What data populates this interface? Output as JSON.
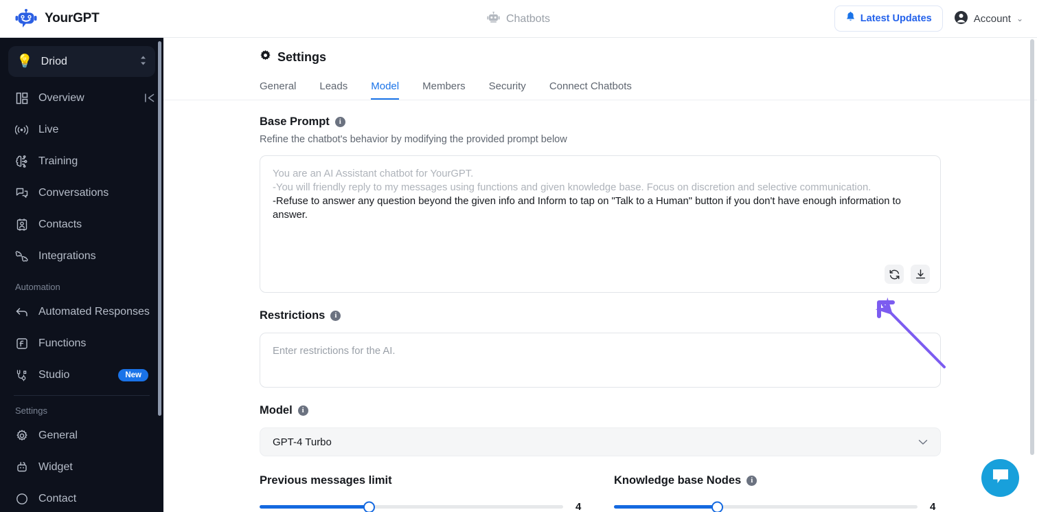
{
  "topbar": {
    "brand_name": "YourGPT",
    "brand_logo_icon": "robot-logo-icon",
    "center_label": "Chatbots",
    "center_icon": "robot-icon",
    "latest_updates_label": "Latest Updates",
    "latest_updates_icon": "bell-icon",
    "account_label": "Account",
    "account_icon": "user-circle-icon",
    "account_chevron_icon": "chevron-down-icon"
  },
  "sidebar": {
    "bot_selector": {
      "icon": "lightbulb-icon",
      "name": "Driod",
      "control_icon": "chevron-up-down-icon"
    },
    "collapse_icon": "collapse-panel-icon",
    "items": [
      {
        "label": "Overview",
        "icon": "layout-dashboard-icon"
      },
      {
        "label": "Live",
        "icon": "broadcast-icon"
      },
      {
        "label": "Training",
        "icon": "brain-circuit-icon"
      },
      {
        "label": "Conversations",
        "icon": "chat-bubbles-icon"
      },
      {
        "label": "Contacts",
        "icon": "contact-card-icon"
      },
      {
        "label": "Integrations",
        "icon": "puzzle-icon"
      }
    ],
    "group_automation_label": "Automation",
    "automation_items": [
      {
        "label": "Automated Responses",
        "icon": "reply-arrow-icon",
        "badge": ""
      },
      {
        "label": "Functions",
        "icon": "function-box-icon",
        "badge": ""
      },
      {
        "label": "Studio",
        "icon": "studio-node-icon",
        "badge": "New"
      }
    ],
    "group_settings_label": "Settings",
    "settings_items": [
      {
        "label": "General",
        "icon": "gear-icon"
      },
      {
        "label": "Widget",
        "icon": "widget-robot-icon"
      },
      {
        "label": "Contact",
        "icon": "contact-icon"
      }
    ]
  },
  "main": {
    "page_icon": "gear-icon",
    "page_title": "Settings",
    "tabs": [
      {
        "label": "General",
        "active": false
      },
      {
        "label": "Leads",
        "active": false
      },
      {
        "label": "Model",
        "active": true
      },
      {
        "label": "Members",
        "active": false
      },
      {
        "label": "Security",
        "active": false
      },
      {
        "label": "Connect Chatbots",
        "active": false
      }
    ],
    "base_prompt": {
      "label": "Base Prompt",
      "info_icon": "info-icon",
      "description": "Refine the chatbot's behavior by modifying the provided prompt below",
      "line1": "You are an AI Assistant chatbot for YourGPT.",
      "line2": "-You will friendly reply to my messages using functions and given knowledge base. Focus on discretion and selective communication.",
      "line3": "-Refuse to answer any question beyond the given info and Inform to tap on \"Talk to a Human\" button if you don't have enough information to answer.",
      "refresh_icon": "refresh-icon",
      "download_icon": "download-icon"
    },
    "restrictions": {
      "label": "Restrictions",
      "info_icon": "info-icon",
      "placeholder": "Enter restrictions for the AI.",
      "value": ""
    },
    "model": {
      "label": "Model",
      "info_icon": "info-icon",
      "selected": "GPT-4 Turbo",
      "chevron_icon": "chevron-down-icon"
    },
    "sliders": [
      {
        "label": "Previous messages limit",
        "value": "4",
        "percent": 36,
        "has_info": false
      },
      {
        "label": "Knowledge base Nodes",
        "value": "4",
        "percent": 34,
        "has_info": true,
        "info_icon": "info-icon"
      }
    ],
    "annotation_arrow": {
      "icon": "annotation-arrow-icon",
      "color": "#7c5cf0"
    }
  },
  "chat_launcher": {
    "icon": "chat-bubble-icon",
    "color": "#18a0db"
  },
  "colors": {
    "accent_blue": "#1a73e8",
    "sidebar_bg": "#0d111c",
    "slider_blue": "#1469e0",
    "arrow_purple": "#7c5cf0",
    "launcher_blue": "#18a0db"
  }
}
